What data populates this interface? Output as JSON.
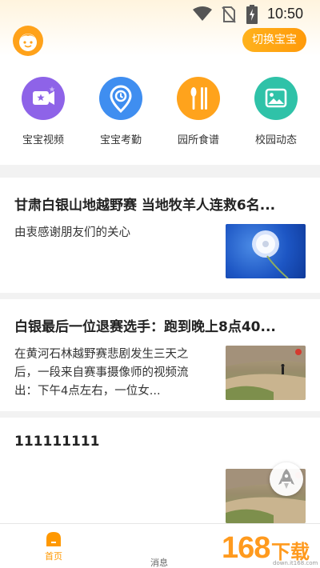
{
  "status_bar": {
    "time": "10:50"
  },
  "header": {
    "switch_label": "切换宝宝"
  },
  "menu": [
    {
      "label": "宝宝视频",
      "icon": "video-icon",
      "color": "#8e63e8"
    },
    {
      "label": "宝宝考勤",
      "icon": "clock-pin-icon",
      "color": "#3f8ef0"
    },
    {
      "label": "园所食谱",
      "icon": "utensils-icon",
      "color": "#ffa31c"
    },
    {
      "label": "校园动态",
      "icon": "picture-icon",
      "color": "#2fc2a8"
    }
  ],
  "articles": [
    {
      "title": "甘肃白银山地越野赛 当地牧羊人连救6名...",
      "desc": "由衷感谢朋友们的关心",
      "thumb": "dandelion-image"
    },
    {
      "title": "白银最后一位退赛选手：跑到晚上8点40...",
      "desc": "在黄河石林越野赛悲剧发生三天之后，一段来自赛事摄像师的视频流出：下午4点左右，一位女...",
      "thumb": "trail-runner-image"
    },
    {
      "title": "111111111",
      "desc": "",
      "thumb": "trail-runner-image"
    }
  ],
  "bottom_nav": {
    "home_label": "首页",
    "messages_label": "消息"
  },
  "watermark": {
    "number": "168",
    "text": "下载",
    "url": "down.it168.com"
  },
  "colors": {
    "accent": "#ff9a0a",
    "background": "#f2f2f2"
  }
}
